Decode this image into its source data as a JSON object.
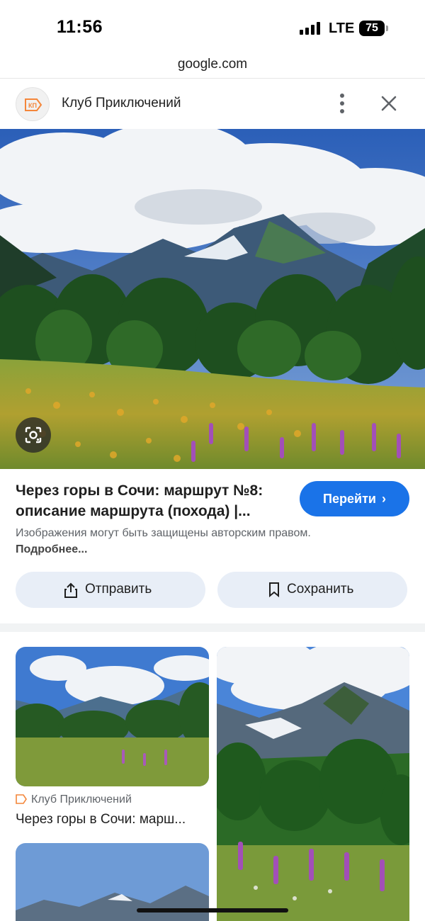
{
  "status_bar": {
    "time": "11:56",
    "network": "LTE",
    "battery": "75"
  },
  "browser": {
    "url": "google.com"
  },
  "source": {
    "name": "Клуб Приключений",
    "logo_text": "КП",
    "brand_color": "#f4863a"
  },
  "icons": {
    "more": "more-vert-icon",
    "close": "close-icon",
    "lens": "google-lens-icon",
    "share": "share-icon",
    "bookmark": "bookmark-icon",
    "chevron": "chevron-right-icon"
  },
  "result": {
    "title": "Через горы в Сочи: маршрут №8:\nописание маршрута (похода) |...",
    "visit_label": "Перейти",
    "copyright_text": "Изображения могут быть защищены авторским правом.",
    "copyright_link": "Подробнее..."
  },
  "actions": {
    "share_label": "Отправить",
    "save_label": "Сохранить"
  },
  "related": [
    {
      "source": "Клуб Приключений",
      "title": "Через горы в Сочи: марш..."
    }
  ],
  "colors": {
    "accent": "#1a73e8",
    "action_bg": "#e8eef7"
  }
}
